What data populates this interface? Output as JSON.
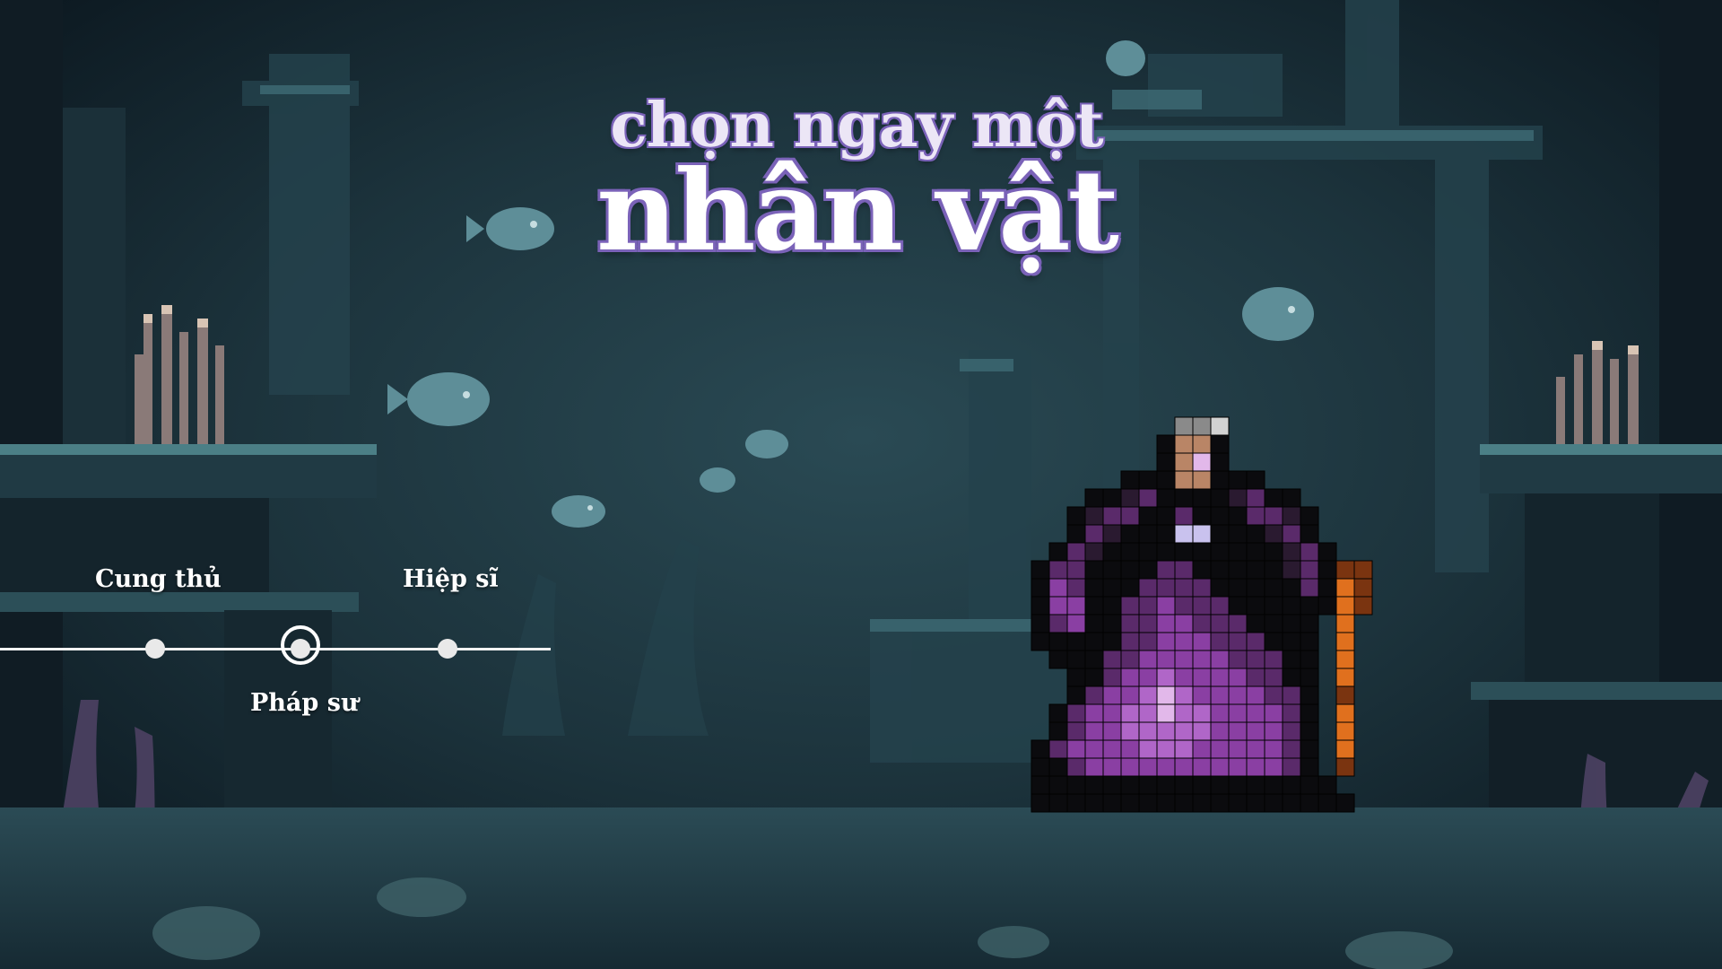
{
  "title": {
    "line1": "chọn ngay một",
    "line2": "nhân vật"
  },
  "character_select": {
    "options": [
      {
        "label": "Cung thủ",
        "selected": false
      },
      {
        "label": "Pháp sư",
        "selected": true
      },
      {
        "label": "Hiệp sĩ",
        "selected": false
      }
    ]
  },
  "colors": {
    "title_fill": "#ffffff",
    "title_outline": "#7a62b8",
    "robe_purple": "#8a3fa3",
    "staff_orange": "#e0701e",
    "water_teal": "#1d3a44"
  },
  "scene_icons": [
    "underwater-ruins-background",
    "fish-icon",
    "coral-icon",
    "seaweed-icon",
    "wizard-sprite",
    "staff-icon"
  ]
}
